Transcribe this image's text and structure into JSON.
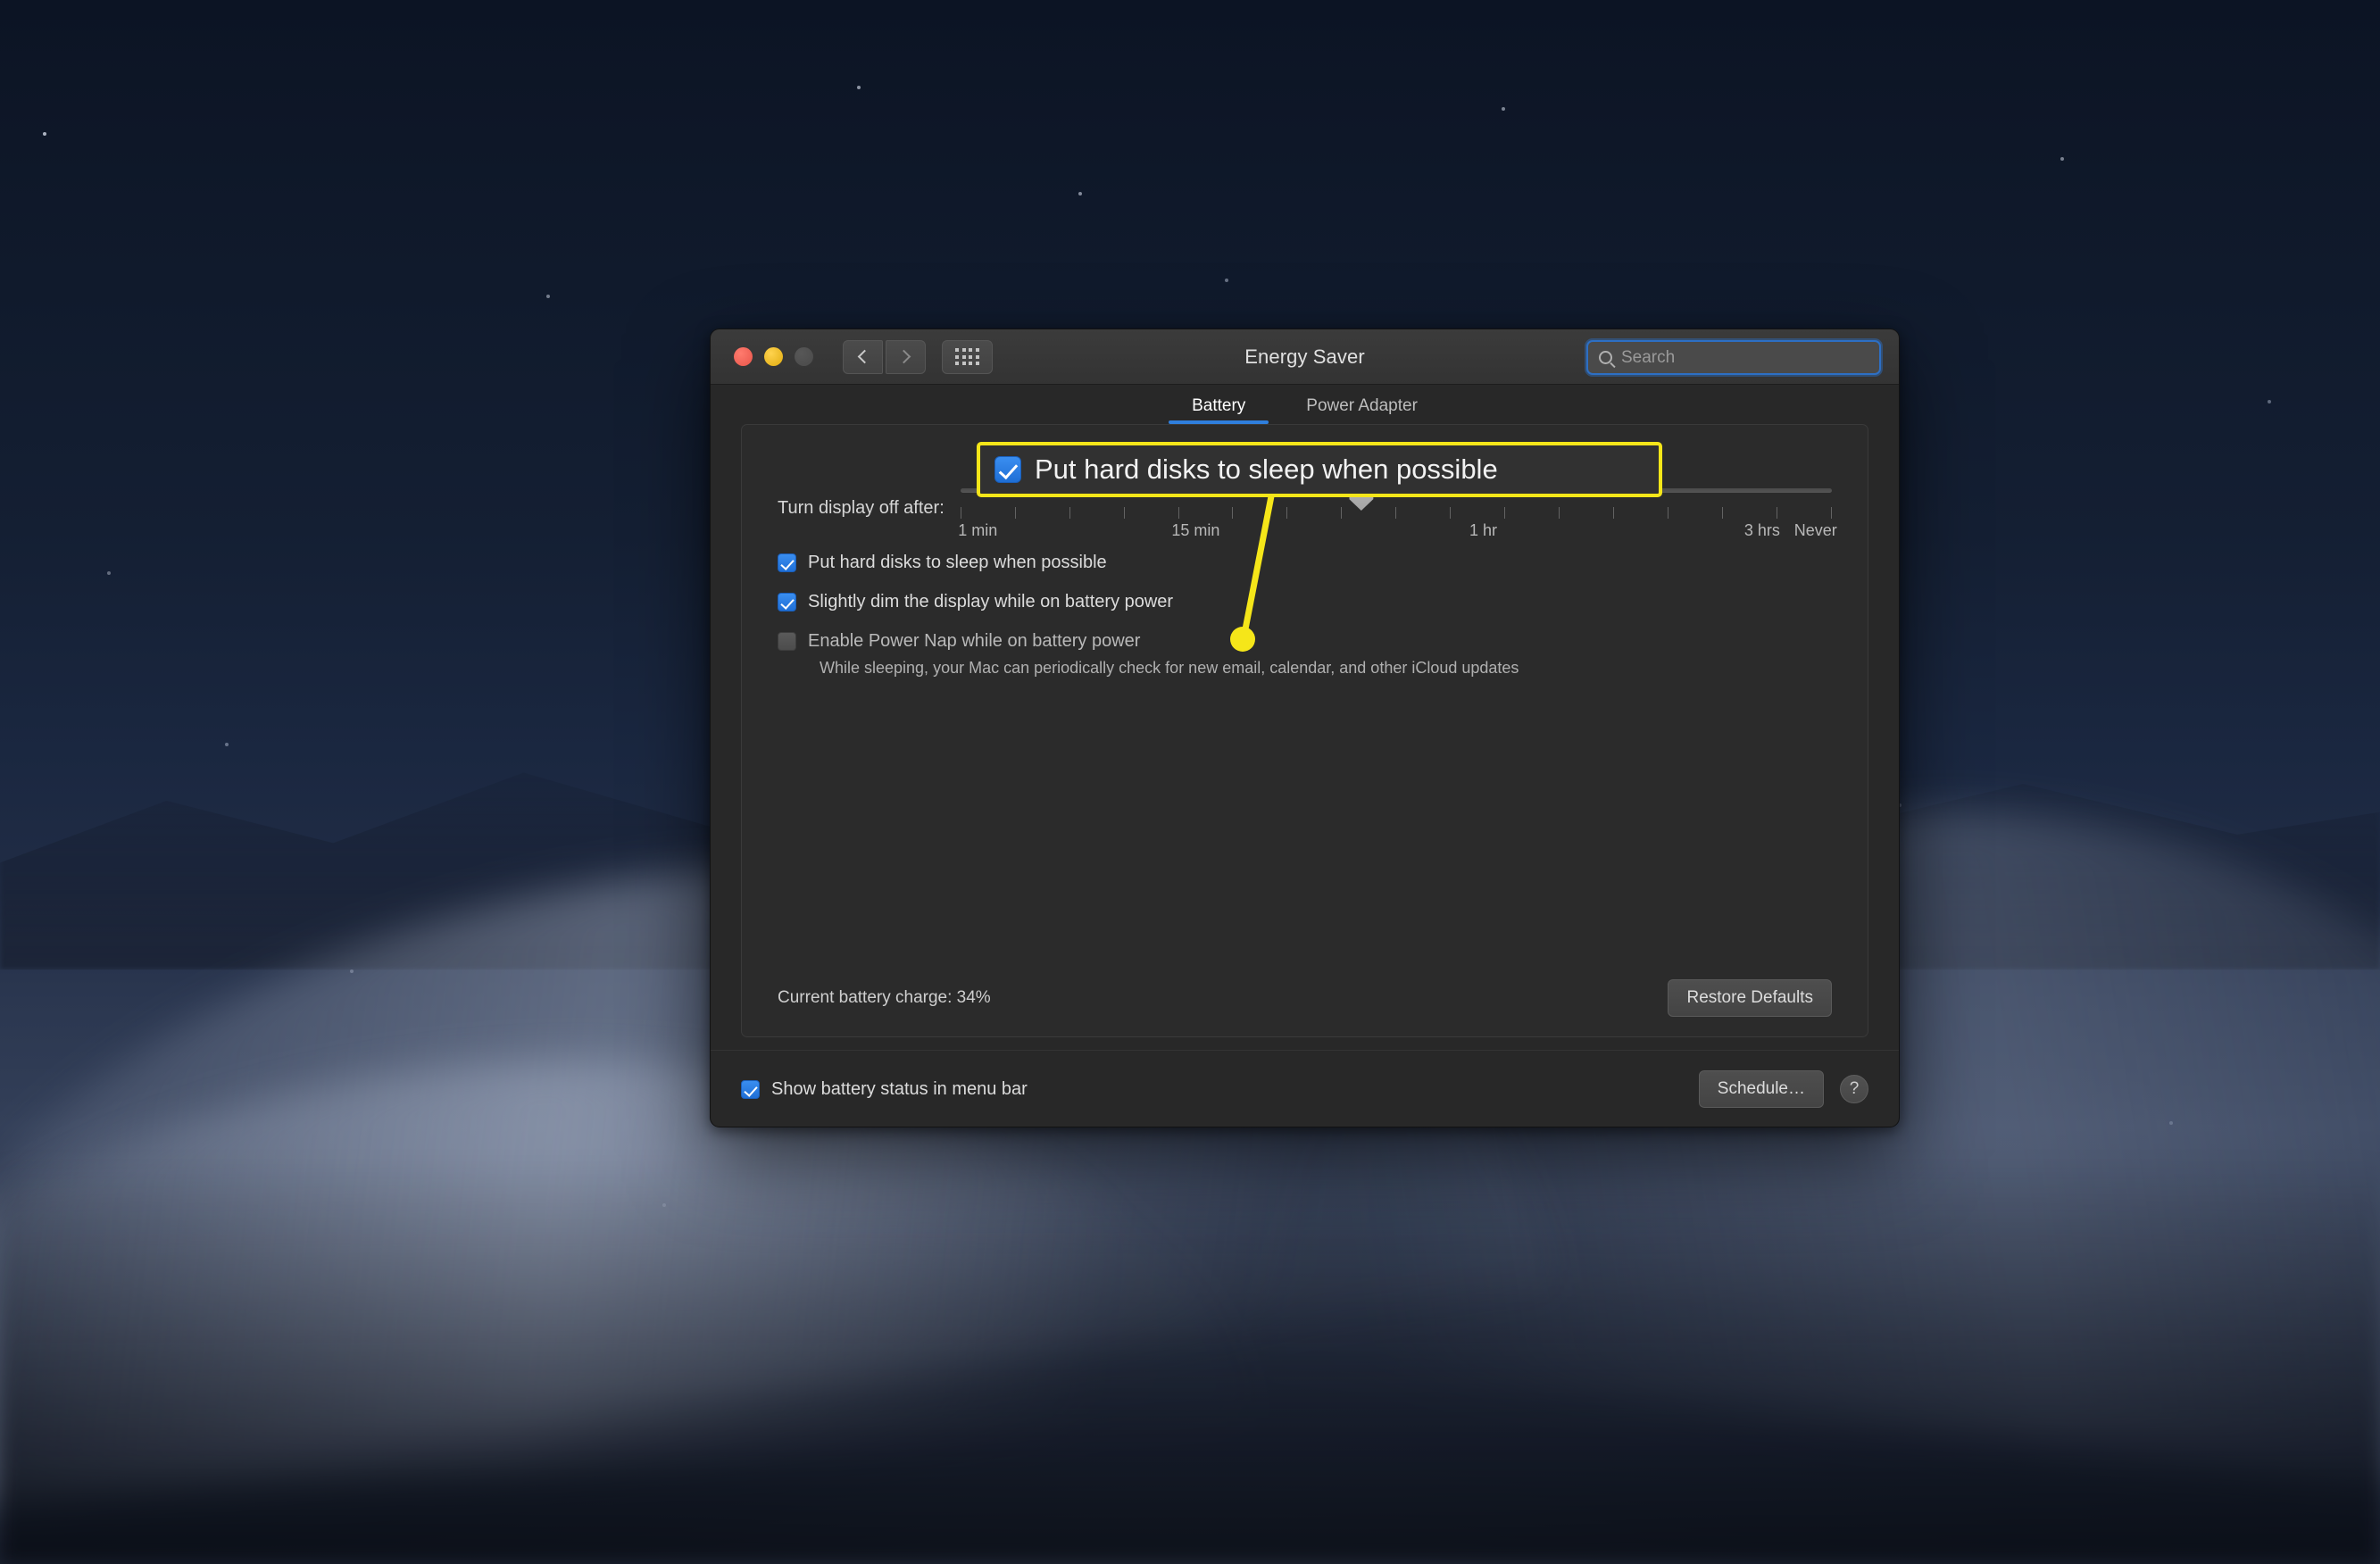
{
  "window": {
    "title": "Energy Saver",
    "traffic_lights": [
      "close",
      "minimize",
      "zoom"
    ],
    "nav": {
      "back_label": "Back",
      "forward_label": "Forward",
      "grid_label": "Show All"
    },
    "search": {
      "placeholder": "Search",
      "value": ""
    }
  },
  "tabs": [
    {
      "label": "Battery",
      "selected": true
    },
    {
      "label": "Power Adapter",
      "selected": false
    }
  ],
  "slider": {
    "label": "Turn display off after:",
    "value_percent": 46,
    "scale_labels": [
      {
        "text": "1 min",
        "percent": 2
      },
      {
        "text": "15 min",
        "percent": 27
      },
      {
        "text": "1 hr",
        "percent": 60
      },
      {
        "text": "3 hrs",
        "percent": 92
      },
      {
        "text": "Never",
        "percent": 100
      }
    ],
    "tick_count": 17
  },
  "options": [
    {
      "label": "Put hard disks to sleep when possible",
      "checked": true,
      "sub": ""
    },
    {
      "label": "Slightly dim the display while on battery power",
      "checked": true,
      "sub": ""
    },
    {
      "label": "Enable Power Nap while on battery power",
      "checked": false,
      "sub": "While sleeping, your Mac can periodically check for new email, calendar, and other iCloud updates"
    }
  ],
  "panel_footer": {
    "battery_charge": "Current battery charge: 34%",
    "restore_defaults_label": "Restore Defaults"
  },
  "bottom_bar": {
    "show_battery_label": "Show battery status in menu bar",
    "show_battery_checked": true,
    "schedule_label": "Schedule…",
    "help_label": "?"
  },
  "callout": {
    "text": "Put hard disks to sleep when possible",
    "checked": true,
    "accent_color": "#f5e619"
  },
  "colors": {
    "accent_blue": "#2f7fdd",
    "checkbox_blue": "#2a7ce0",
    "highlight_yellow": "#f5e619",
    "window_bg": "#282828",
    "panel_bg": "#2b2b2b"
  }
}
